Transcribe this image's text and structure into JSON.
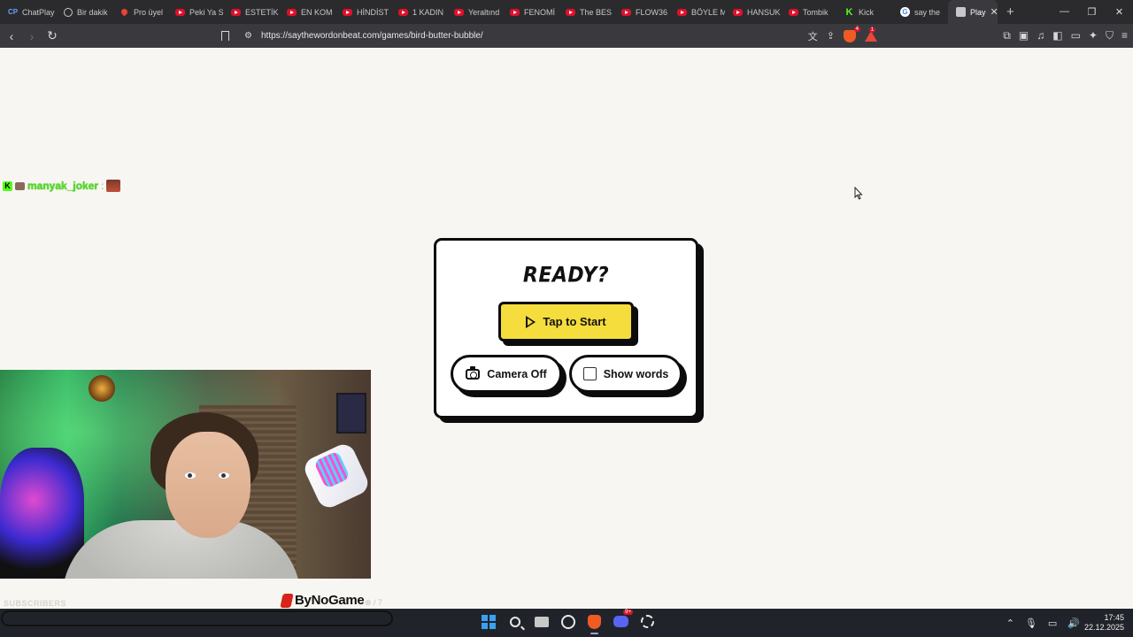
{
  "browser": {
    "tabs": [
      {
        "label": "ChatPlay",
        "favicon": "chatplay-icon"
      },
      {
        "label": "Bir dakik",
        "favicon": "globe-icon"
      },
      {
        "label": "Pro üyel",
        "favicon": "pin-icon"
      },
      {
        "label": "Peki Ya S",
        "favicon": "youtube-icon"
      },
      {
        "label": "ESTETİK",
        "favicon": "youtube-icon"
      },
      {
        "label": "EN KOM",
        "favicon": "youtube-icon"
      },
      {
        "label": "HİNDİST",
        "favicon": "youtube-icon"
      },
      {
        "label": "1 KADIN",
        "favicon": "youtube-icon"
      },
      {
        "label": "Yeraltınd",
        "favicon": "youtube-icon"
      },
      {
        "label": "FENOMİ",
        "favicon": "youtube-icon"
      },
      {
        "label": "The BES",
        "favicon": "youtube-icon"
      },
      {
        "label": "FLOW36",
        "favicon": "youtube-icon"
      },
      {
        "label": "BÖYLE M",
        "favicon": "youtube-icon"
      },
      {
        "label": "HANSUK",
        "favicon": "youtube-icon"
      },
      {
        "label": "Tombik",
        "favicon": "youtube-icon"
      },
      {
        "label": "Kick",
        "favicon": "kick-icon"
      },
      {
        "label": "say the",
        "favicon": "google-icon"
      },
      {
        "label": "Play",
        "favicon": "image-icon",
        "active": true
      }
    ],
    "url": "https://saythewordonbeat.com/games/bird-butter-bubble/",
    "brave_badge": "4",
    "rewards_badge": "1"
  },
  "chat": {
    "platform_badge": "K",
    "username": "manyak_joker",
    "separator": ":"
  },
  "game": {
    "heading": "READY?",
    "start_label": "Tap to Start",
    "camera_label": "Camera Off",
    "words_label": "Show words",
    "words_checked": false
  },
  "overlay": {
    "subscribers_label": "SUBSCRIBERS",
    "sponsor_text": "ByNoGame",
    "sponsor_tail": "⊕ / 7"
  },
  "taskbar": {
    "discord_badge": "9+",
    "time": "17:45",
    "date": "22.12.2025"
  },
  "colors": {
    "start_button": "#f4dd3c",
    "chat_username": "#4ce01d",
    "kick_green": "#53fc18",
    "page_bg": "#f8f6f2"
  }
}
